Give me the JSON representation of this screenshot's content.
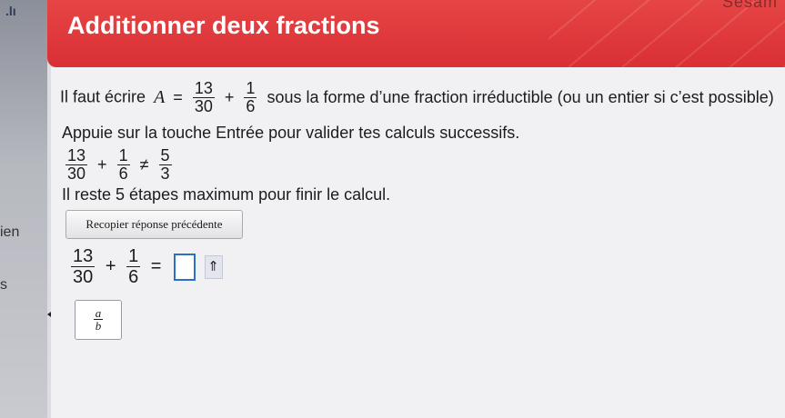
{
  "sidebar": {
    "glyph": ".lı",
    "label_1": "ien",
    "label_2": "s"
  },
  "header": {
    "title": "Additionner deux fractions",
    "corner_text": "Sesam"
  },
  "instruction": {
    "prefix": "Il faut écrire",
    "var": "A",
    "eq": "=",
    "frac1": {
      "num": "13",
      "den": "30"
    },
    "plus": "+",
    "frac2": {
      "num": "1",
      "den": "6"
    },
    "suffix": "sous la forme d’une fraction irréductible (ou un entier si c’est possible)"
  },
  "hint": "Appuie sur la touche Entrée pour valider tes calculs successifs.",
  "previous_attempt": {
    "frac1": {
      "num": "13",
      "den": "30"
    },
    "plus": "+",
    "frac2": {
      "num": "1",
      "den": "6"
    },
    "neq": "≠",
    "frac3": {
      "num": "5",
      "den": "3"
    }
  },
  "remaining": "Il reste 5 étapes maximum pour finir le calcul.",
  "copy_button": "Recopier réponse précédente",
  "current": {
    "frac1": {
      "num": "13",
      "den": "30"
    },
    "plus": "+",
    "frac2": {
      "num": "1",
      "den": "6"
    },
    "eq": "=",
    "arrow": "⇑"
  },
  "fraction_tool": {
    "num": "a",
    "den": "b"
  }
}
